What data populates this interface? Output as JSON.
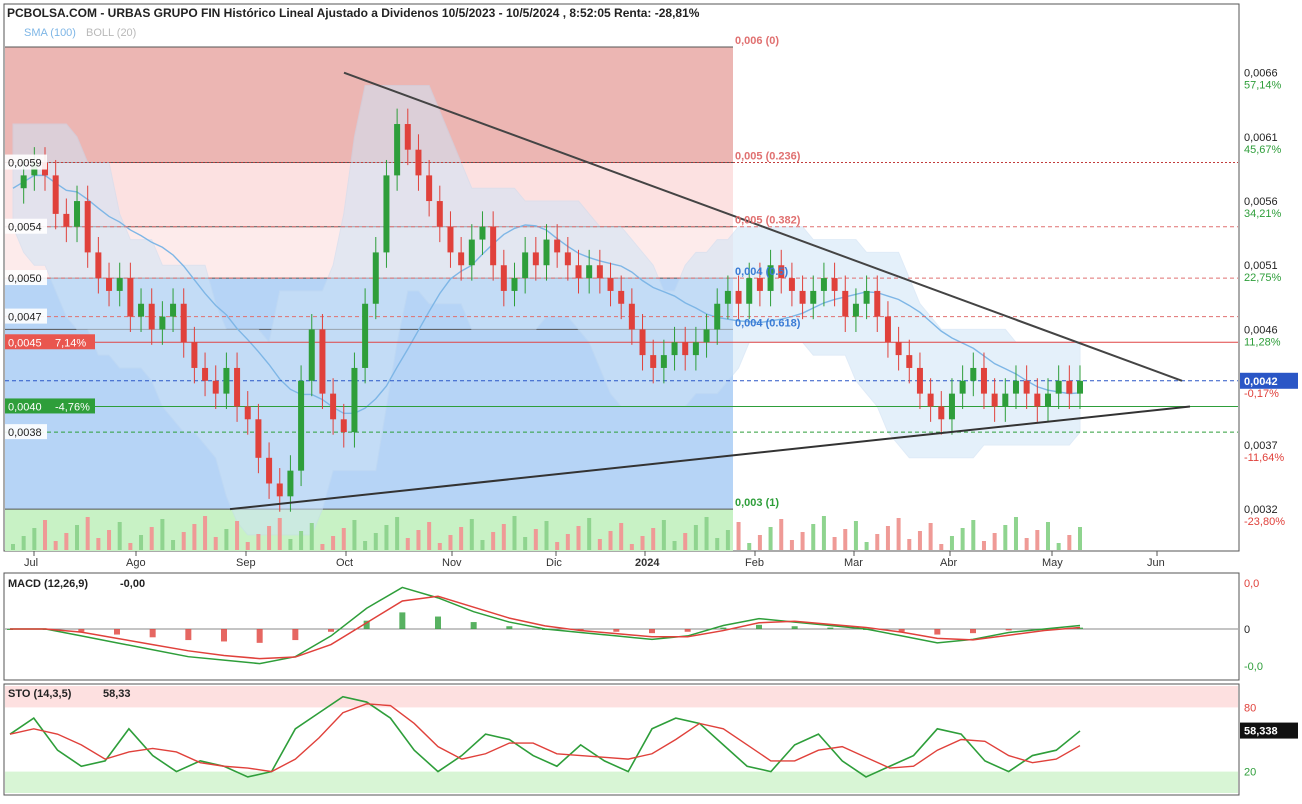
{
  "header": {
    "title": "PCBOLSA.COM - URBAS GRUPO FIN Histórico Lineal Ajustado a Dividenos 10/5/2023 - 10/5/2024 , 8:52:05 Renta: -28,81%",
    "legend_sma": "SMA (100)",
    "legend_boll": "BOLL (20)"
  },
  "colors": {
    "up": "#2e9e3a",
    "down": "#e0413b",
    "fib_red_dark": "#e9a9a6",
    "fib_red_light": "#fbdcdc",
    "fib_blue": "#a9cdf5",
    "fib_green": "#c8f2c5",
    "boll_band": "#cfe4f7",
    "sma": "#7eb6e6",
    "current_price": "#2a56c6"
  },
  "chart_data": [
    {
      "type": "candlestick",
      "months": [
        "Jul",
        "Ago",
        "Sep",
        "Oct",
        "Nov",
        "Dic",
        "2024",
        "Feb",
        "Mar",
        "Abr",
        "May",
        "Jun"
      ],
      "y_axis": {
        "min": 0.0031,
        "max": 0.0068,
        "ticks": [
          {
            "value": 0.0066,
            "label": "0,0066",
            "pct": "57,14%"
          },
          {
            "value": 0.0061,
            "label": "0,0061",
            "pct": "45,67%"
          },
          {
            "value": 0.0056,
            "label": "0,0056",
            "pct": "34,21%"
          },
          {
            "value": 0.0051,
            "label": "0,0051",
            "pct": "22,75%"
          },
          {
            "value": 0.0046,
            "label": "0,0046",
            "pct": "11,28%"
          },
          {
            "value": 0.0042,
            "label": "",
            "pct": "-0,17%"
          },
          {
            "value": 0.0037,
            "label": "0,0037",
            "pct": "-11,64%"
          },
          {
            "value": 0.0032,
            "label": "0,0032",
            "pct": "-23,80%"
          }
        ]
      },
      "current_price": {
        "value": 0.0042,
        "label": "0,0042"
      },
      "left_levels": [
        {
          "value": 0.0059,
          "label": "0,0059"
        },
        {
          "value": 0.0054,
          "label": "0,0054"
        },
        {
          "value": 0.005,
          "label": "0,0050"
        },
        {
          "value": 0.0047,
          "label": "0,0047"
        },
        {
          "value": 0.0045,
          "label": "0,0045",
          "pct": "7,14%"
        },
        {
          "value": 0.004,
          "label": "0,0040",
          "pct": "-4,76%"
        },
        {
          "value": 0.0038,
          "label": "0,0038"
        }
      ],
      "fibonacci": [
        {
          "value": 0.0068,
          "label": "0,006 (0)"
        },
        {
          "value": 0.0059,
          "label": "0,005 (0.236)"
        },
        {
          "value": 0.0054,
          "label": "0,005 (0.382)"
        },
        {
          "value": 0.005,
          "label": "0,004 (0.5)"
        },
        {
          "value": 0.0046,
          "label": "0,004 (0.618)"
        },
        {
          "value": 0.0032,
          "label": "0,003 (1)"
        }
      ],
      "close_series": [
        0.0057,
        0.0058,
        0.0059,
        0.0058,
        0.0055,
        0.0054,
        0.0056,
        0.0052,
        0.005,
        0.0049,
        0.005,
        0.0047,
        0.0048,
        0.0046,
        0.0047,
        0.0048,
        0.0045,
        0.0043,
        0.0042,
        0.0041,
        0.0043,
        0.004,
        0.0039,
        0.0036,
        0.0034,
        0.0033,
        0.0035,
        0.0042,
        0.0046,
        0.0041,
        0.0039,
        0.0038,
        0.0043,
        0.0048,
        0.0052,
        0.0058,
        0.0062,
        0.006,
        0.0058,
        0.0056,
        0.0054,
        0.0052,
        0.0051,
        0.0053,
        0.0054,
        0.0051,
        0.0049,
        0.005,
        0.0052,
        0.0051,
        0.0053,
        0.0052,
        0.0051,
        0.005,
        0.0051,
        0.005,
        0.0049,
        0.0048,
        0.0046,
        0.0044,
        0.0043,
        0.0044,
        0.0045,
        0.0044,
        0.0045,
        0.0046,
        0.0048,
        0.0049,
        0.0048,
        0.005,
        0.0049,
        0.0051,
        0.005,
        0.0049,
        0.0048,
        0.0049,
        0.005,
        0.0049,
        0.0047,
        0.0048,
        0.0049,
        0.0047,
        0.0045,
        0.0044,
        0.0043,
        0.0041,
        0.004,
        0.0039,
        0.0041,
        0.0042,
        0.0043,
        0.0041,
        0.004,
        0.0041,
        0.0042,
        0.0041,
        0.004,
        0.0041,
        0.0042,
        0.0041,
        0.0042
      ],
      "trendlines": [
        {
          "from": [
            "Sep-mid",
            0.0066
          ],
          "to": [
            "Jun",
            0.0042
          ]
        },
        {
          "from": [
            "Sep",
            0.0032
          ],
          "to": [
            "Jun",
            0.004
          ]
        }
      ]
    },
    {
      "type": "macd",
      "label": "MACD (12,26,9)",
      "value": "-0,00",
      "ticks": [
        "0,0",
        "0",
        "-0,0"
      ],
      "series": [
        0,
        0,
        -0.0002,
        -0.0004,
        -0.0006,
        -0.0008,
        -0.0009,
        -0.001,
        -0.0008,
        -0.0002,
        0.0006,
        0.0012,
        0.0009,
        0.0005,
        0.0002,
        0,
        -0.0001,
        -0.0002,
        -0.0003,
        -0.0002,
        0.0001,
        0.0003,
        0.0002,
        0.0001,
        0,
        -0.0002,
        -0.0004,
        -0.0003,
        -0.0001,
        0,
        0.0001
      ]
    },
    {
      "type": "stochastic",
      "label": "STO (14,3,5)",
      "value": "58,33",
      "current": "58,338",
      "ticks": [
        "80",
        "20"
      ],
      "series": [
        55,
        70,
        40,
        25,
        30,
        60,
        35,
        20,
        30,
        25,
        15,
        20,
        60,
        75,
        90,
        85,
        70,
        40,
        20,
        35,
        55,
        50,
        35,
        25,
        45,
        30,
        20,
        60,
        70,
        65,
        45,
        25,
        20,
        45,
        55,
        30,
        15,
        25,
        35,
        60,
        55,
        30,
        20,
        35,
        40,
        58
      ]
    }
  ]
}
